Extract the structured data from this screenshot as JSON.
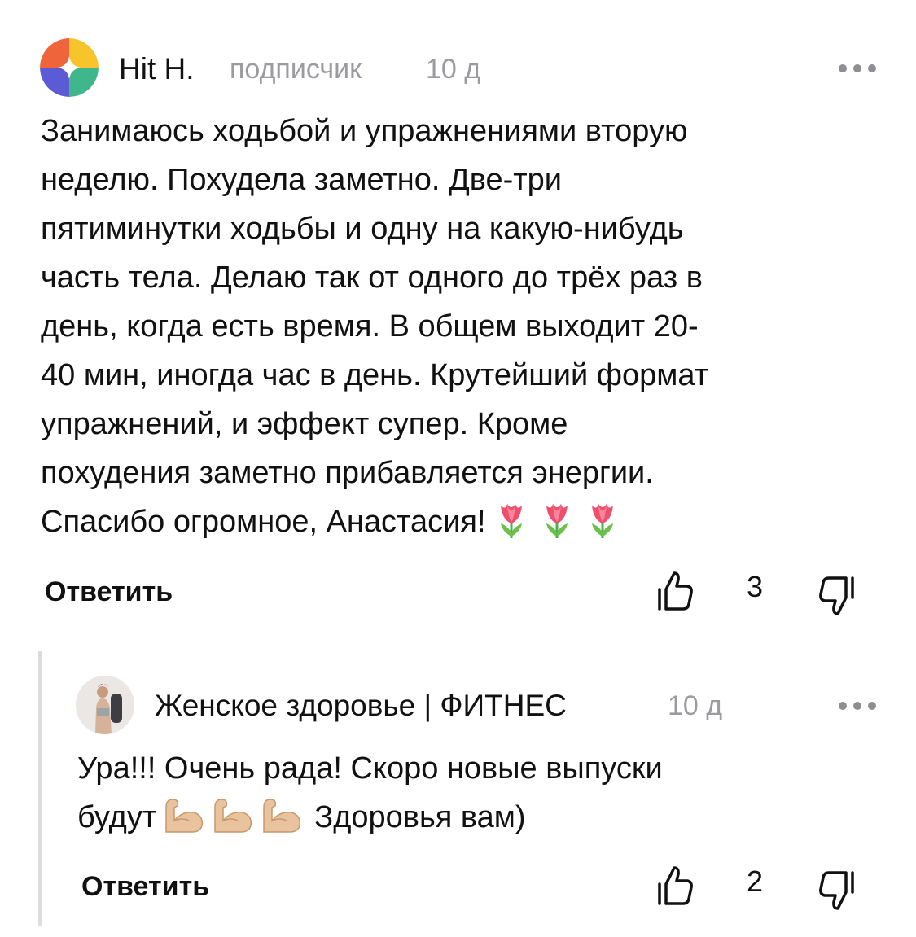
{
  "comments": [
    {
      "author": "Hit H.",
      "role": "подписчик",
      "time": "10 д",
      "avatar_colors": [
        "#f5a623",
        "#e94b3c",
        "#4a90e2",
        "#7ed321",
        "#8e44ad"
      ],
      "more_icon": "ellipsis-icon",
      "text_lines": [
        "Занимаюсь ходьбой и упражнениями вторую",
        "неделю. Похудела заметно. Две-три",
        "пятиминутки ходьбы и одну на какую-нибудь",
        "часть тела. Делаю так от одного до трёх раз в",
        "день, когда есть время. В общем выходит 20-",
        "40 мин, иногда час в день. Крутейший формат",
        "упражнений, и эффект супер. Кроме",
        "похудения заметно прибавляется энергии.",
        "Спасибо огромное, Анастасия!"
      ],
      "emojis": [
        "tulip-emoji",
        "tulip-emoji",
        "tulip-emoji"
      ],
      "reply_label": "Ответить",
      "like_count": "3"
    },
    {
      "author": "Женское здоровье | ФИТНЕС",
      "time": "10 д",
      "more_icon": "ellipsis-icon",
      "text_lines": [
        "Ура!!! Очень рада! Скоро новые выпуски",
        "будут",
        "Здоровья вам)"
      ],
      "emojis": [
        "flexed-biceps-emoji",
        "flexed-biceps-emoji",
        "flexed-biceps-emoji"
      ],
      "reply_label": "Ответить",
      "like_count": "2"
    }
  ]
}
